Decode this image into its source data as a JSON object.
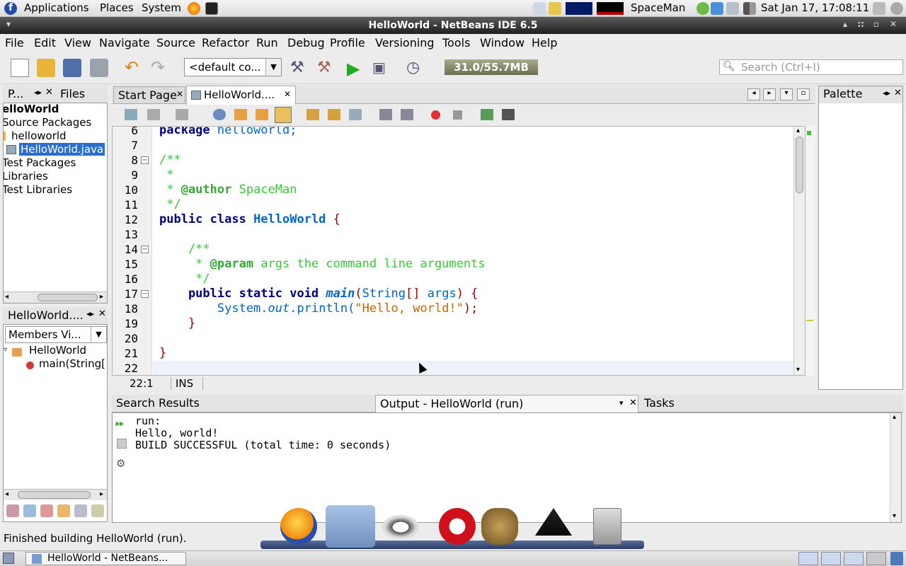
{
  "top_panel": {
    "menus": [
      "Applications",
      "Places",
      "System"
    ],
    "user": "SpaceMan",
    "clock": "Sat Jan 17, 17:08:11"
  },
  "window": {
    "title": "HelloWorld - NetBeans IDE 6.5"
  },
  "menubar": [
    "File",
    "Edit",
    "View",
    "Navigate",
    "Source",
    "Refactor",
    "Run",
    "Debug",
    "Profile",
    "Versioning",
    "Tools",
    "Window",
    "Help"
  ],
  "toolbar": {
    "config_combo": "<default co...",
    "memory": "31.0/55.7MB",
    "search_placeholder": "Search (Ctrl+I)"
  },
  "projects_panel": {
    "tabs": [
      "P...",
      "Files"
    ],
    "tree": [
      "elloWorld",
      "Source Packages",
      "helloworld",
      "HelloWorld.java",
      "Test Packages",
      "Libraries",
      "Test Libraries"
    ]
  },
  "navigator_panel": {
    "title": "HelloWorld....",
    "combo": "Members Vi...",
    "tree": [
      "HelloWorld",
      "main(String["
    ]
  },
  "editor": {
    "tabs": [
      "Start Page",
      "HelloWorld...."
    ],
    "lines": [
      "6",
      "7",
      "8",
      "9",
      "10",
      "11",
      "12",
      "13",
      "14",
      "15",
      "16",
      "17",
      "18",
      "19",
      "20",
      "21",
      "22"
    ],
    "status_pos": "22:1",
    "status_mode": "INS",
    "code": {
      "l6_kw": "package",
      "l6_rest": " helloworld;",
      "l8": "/**",
      "l9": " *",
      "l10_a": " * ",
      "l10_tag": "@author",
      "l10_b": " SpaceMan",
      "l11": " */",
      "l12_kw": "public class ",
      "l12_cls": "HelloWorld",
      "l12_br": " {",
      "l14": "    /**",
      "l15_a": "     * ",
      "l15_tag": "@param",
      "l15_b": " args the command line arguments",
      "l16": "     */",
      "l17_kw": "    public static void ",
      "l17_m": "main",
      "l17_a": "(",
      "l17_t": "String",
      "l17_b": "[] ",
      "l17_args": "args",
      "l17_c": ") {",
      "l18_a": "        System.",
      "l18_out": "out",
      "l18_b": ".println(",
      "l18_str": "\"Hello, world!\"",
      "l18_c": ");",
      "l19": "    }",
      "l21": "}"
    }
  },
  "palette": {
    "title": "Palette"
  },
  "bottom_tabs": [
    "Search Results",
    "Output - HelloWorld (run)",
    "Tasks"
  ],
  "output": [
    "run:",
    "Hello, world!",
    "BUILD SUCCESSFUL (total time: 0 seconds)"
  ],
  "status_bar": "Finished building HelloWorld (run).",
  "taskbar": {
    "button": "HelloWorld - NetBeans..."
  }
}
